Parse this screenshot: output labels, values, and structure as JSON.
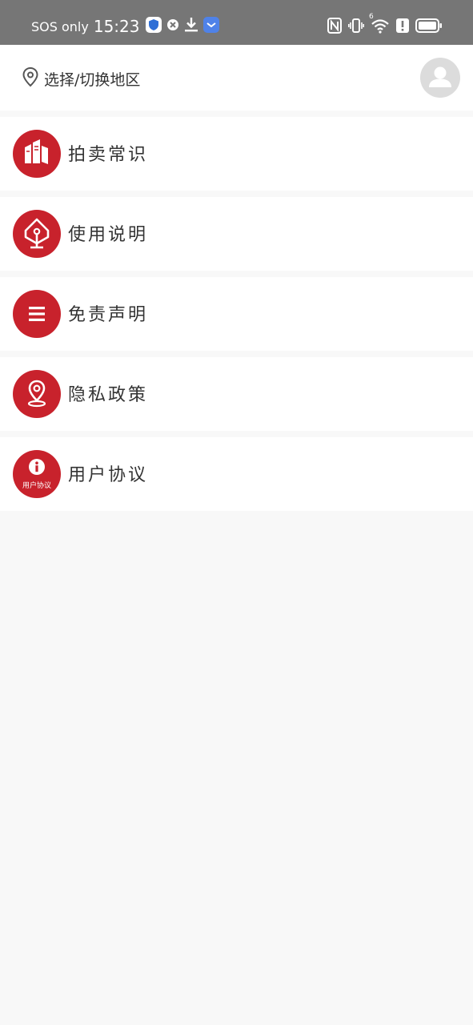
{
  "status_bar": {
    "carrier": "SOS only",
    "time": "15:23",
    "icons": [
      "shield-icon",
      "close-circle-icon",
      "download-icon",
      "app-badge-icon",
      "nfc-icon",
      "vibrate-icon",
      "wifi-icon",
      "alert-icon",
      "battery-icon"
    ],
    "wifi_badge": "6"
  },
  "header": {
    "location_icon": "location-pin-icon",
    "location_label": "选择/切换地区",
    "avatar_icon": "user-avatar-icon"
  },
  "menu": {
    "items": [
      {
        "label": "拍卖常识",
        "icon": "books-icon"
      },
      {
        "label": "使用说明",
        "icon": "house-icon"
      },
      {
        "label": "免责声明",
        "icon": "list-icon"
      },
      {
        "label": "隐私政策",
        "icon": "map-pin-icon"
      },
      {
        "label": "用户协议",
        "icon": "info-icon",
        "icon_caption": "用户协议"
      }
    ]
  },
  "colors": {
    "accent": "#c8222c",
    "status_bar": "#767676",
    "background": "#f8f8f8",
    "card": "#ffffff"
  }
}
